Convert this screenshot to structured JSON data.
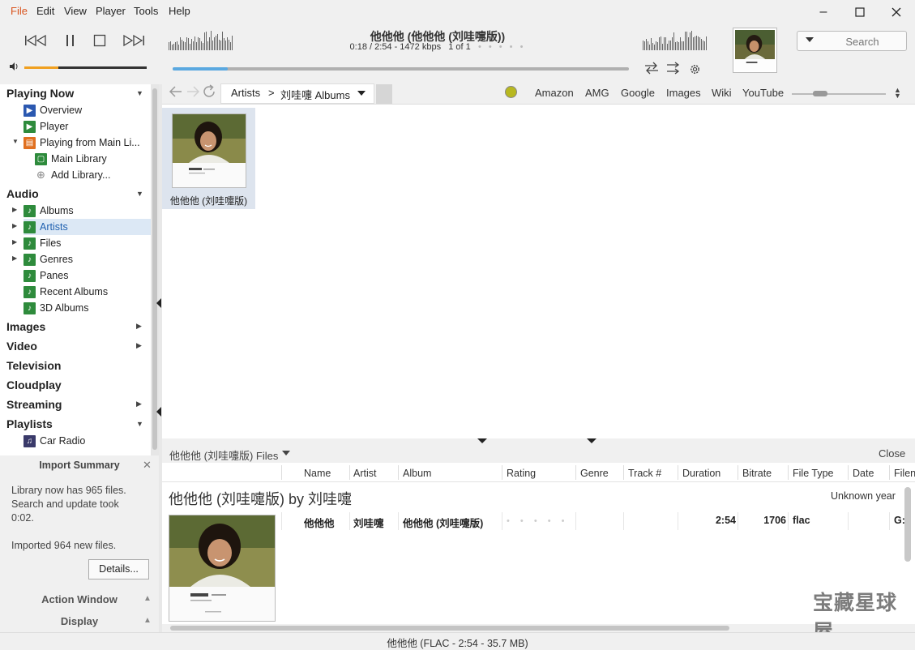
{
  "menu": {
    "items": [
      "File",
      "Edit",
      "View",
      "Player",
      "Tools",
      "Help"
    ]
  },
  "window": {
    "minimize_icon": "minimize-icon",
    "maximize_icon": "maximize-icon",
    "close_icon": "close-icon"
  },
  "player": {
    "title": "他他他 (他他他 (刘哇嚏版))",
    "time": "0:18 / 2:54 - 1472 kbps",
    "position": "1 of 1",
    "rating_dots": "• • • • •",
    "volume_fraction": 0.28,
    "seek_fraction": 0.12
  },
  "search": {
    "placeholder": "Search"
  },
  "tree": {
    "sections": {
      "playing_now": "Playing Now",
      "audio": "Audio",
      "images": "Images",
      "video": "Video",
      "television": "Television",
      "cloudplay": "Cloudplay",
      "streaming": "Streaming",
      "playlists": "Playlists"
    },
    "playing_now_items": [
      "Overview",
      "Player",
      "Playing from Main Li...",
      "Main Library",
      "Add Library..."
    ],
    "audio_items": [
      "Albums",
      "Artists",
      "Files",
      "Genres",
      "Panes",
      "Recent Albums",
      "3D Albums"
    ],
    "playlist_items": [
      "Car Radio"
    ],
    "selected": "Artists"
  },
  "import_summary": {
    "title": "Import Summary",
    "line1": "Library now has 965 files.",
    "line2": "Search and update took",
    "line3": "0:02.",
    "line4": "Imported 964 new files.",
    "details_button": "Details..."
  },
  "panels": {
    "action_window": "Action Window",
    "display": "Display"
  },
  "view": {
    "breadcrumb_root": "Artists",
    "breadcrumb_sep": ">",
    "breadcrumb_current": "刘哇嚏 Albums",
    "web_links": [
      "Amazon",
      "AMG",
      "Google",
      "Images",
      "Wiki",
      "YouTube"
    ]
  },
  "album": {
    "label": "他他他 (刘哇嚏版)"
  },
  "files": {
    "title": "他他他 (刘哇嚏版) Files",
    "close": "Close",
    "columns": [
      "Name",
      "Artist",
      "Album",
      "Rating",
      "Genre",
      "Track #",
      "Duration",
      "Bitrate",
      "File Type",
      "Date",
      "Filen"
    ],
    "group_title": "他他他 (刘哇嚏版) by 刘哇嚏",
    "group_year": "Unknown year",
    "row": {
      "name": "他他他",
      "artist": "刘哇嚏",
      "album": "他他他 (刘哇嚏版)",
      "rating": "• • • • •",
      "duration": "2:54",
      "bitrate": "1706",
      "filetype": "flac",
      "filename": "G:"
    }
  },
  "watermark": "宝藏星球屋",
  "status": "他他他 (FLAC - 2:54 - 35.7 MB)",
  "colors": {
    "accent": "#d9541e",
    "volume": "#f0a020",
    "seek": "#5aa8e0",
    "selection": "#dce8f5"
  }
}
